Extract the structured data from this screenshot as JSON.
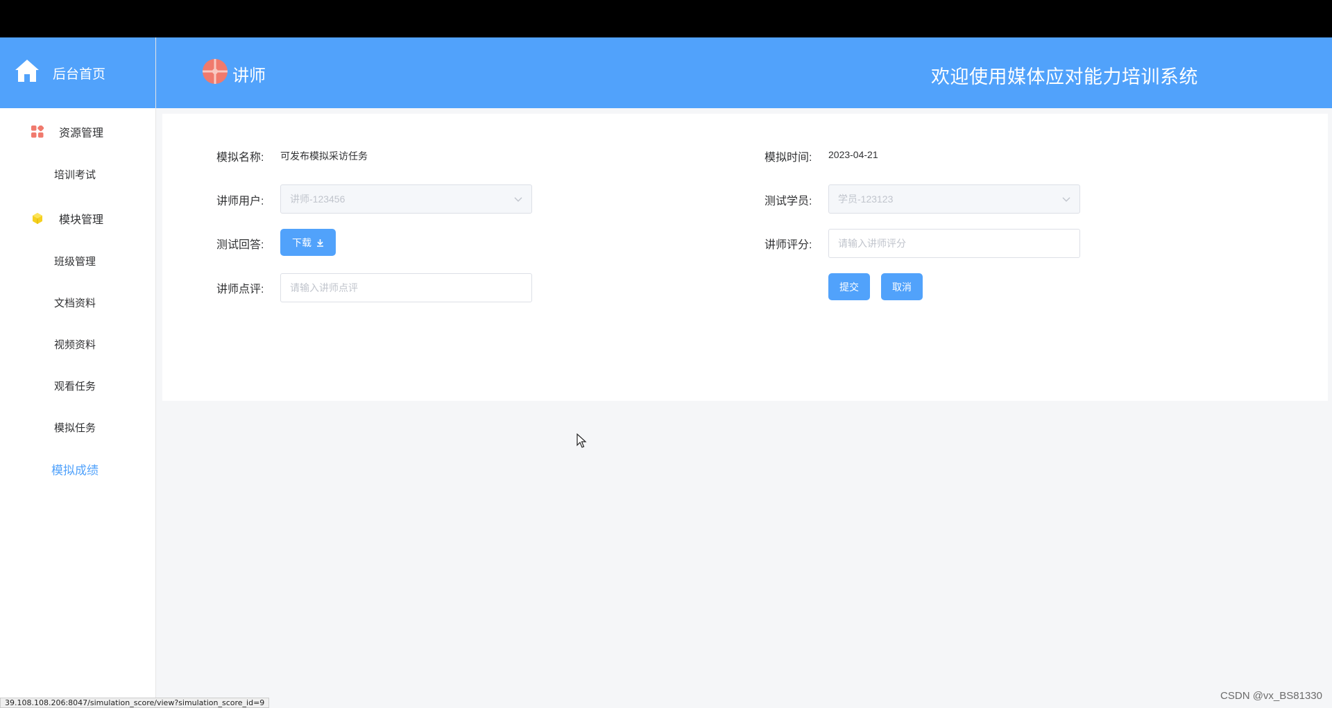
{
  "sidebar": {
    "home_label": "后台首页",
    "groups": [
      {
        "label": "资源管理",
        "icon": "apps-grid-icon",
        "items": [
          {
            "label": "培训考试"
          }
        ]
      },
      {
        "label": "模块管理",
        "icon": "cube-icon",
        "items": [
          {
            "label": "班级管理"
          },
          {
            "label": "文档资料"
          },
          {
            "label": "视频资料"
          },
          {
            "label": "观看任务"
          },
          {
            "label": "模拟任务"
          },
          {
            "label": "模拟成绩",
            "active": true
          }
        ]
      }
    ]
  },
  "header": {
    "role": "讲师",
    "welcome": "欢迎使用媒体应对能力培训系统"
  },
  "form": {
    "sim_name": {
      "label": "模拟名称:",
      "value": "可发布模拟采访任务"
    },
    "sim_time": {
      "label": "模拟时间:",
      "value": "2023-04-21"
    },
    "teacher_user": {
      "label": "讲师用户:",
      "value": "讲师-123456"
    },
    "test_student": {
      "label": "测试学员:",
      "value": "学员-123123"
    },
    "test_answer": {
      "label": "测试回答:",
      "button": "下载"
    },
    "teacher_score": {
      "label": "讲师评分:",
      "placeholder": "请输入讲师评分"
    },
    "teacher_comment": {
      "label": "讲师点评:",
      "placeholder": "请输入讲师点评"
    },
    "submit": "提交",
    "cancel": "取消"
  },
  "browser": {
    "status_url": "39.108.108.206:8047/simulation_score/view?simulation_score_id=9"
  },
  "watermark": "CSDN @vx_BS81330",
  "colors": {
    "primary": "#51a2fb",
    "active_menu": "#51a2fb",
    "background": "#f5f6f8"
  }
}
